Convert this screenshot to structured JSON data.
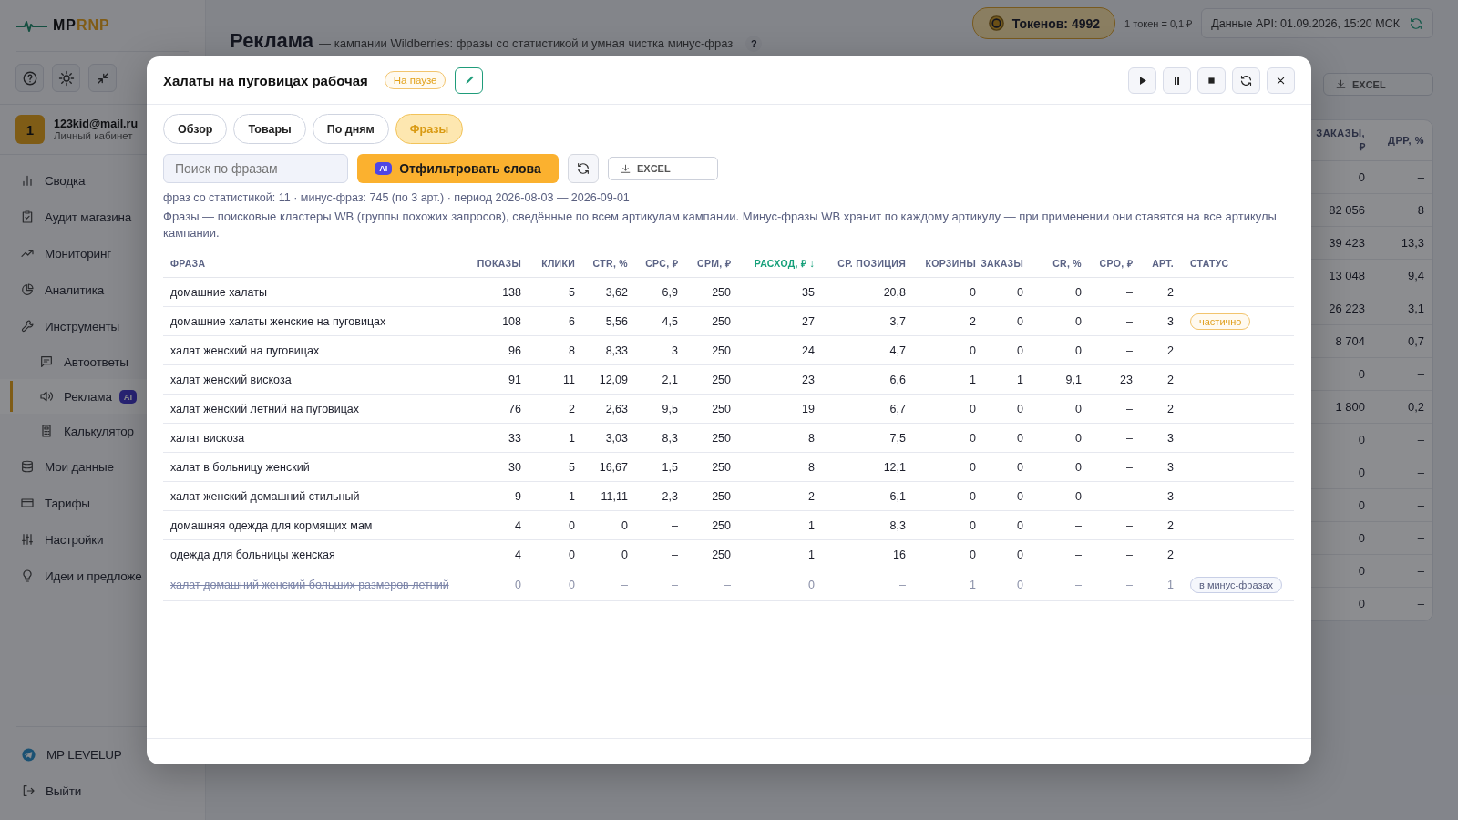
{
  "sidebar": {
    "logo": [
      "MP",
      "RNP"
    ],
    "user": {
      "avatar": "1",
      "email": "123kid@mail.ru",
      "subtitle": "Личный кабинет"
    },
    "nav": [
      {
        "label": "Сводка",
        "selected": false
      },
      {
        "label": "Аудит магазина",
        "selected": false
      },
      {
        "label": "Мониторинг",
        "selected": false
      },
      {
        "label": "Аналитика",
        "selected": false
      },
      {
        "label": "Инструменты",
        "selected": false,
        "children": [
          {
            "label": "Автоответы",
            "selected": false
          },
          {
            "label": "Реклама",
            "selected": true,
            "badge": "AI"
          },
          {
            "label": "Калькулятор",
            "selected": false
          }
        ]
      },
      {
        "label": "Мои данные",
        "selected": false
      },
      {
        "label": "Тарифы",
        "selected": false
      },
      {
        "label": "Настройки",
        "selected": false
      },
      {
        "label": "Идеи и предложе",
        "selected": false
      }
    ],
    "bottom_nav": [
      "MP LEVELUP",
      "Выйти"
    ]
  },
  "header": {
    "title": "Реклама",
    "subtitle": "— кампании Wildberries: фразы со статистикой и умная чистка минус-фраз",
    "help": "?",
    "tokens": "Токенов: 4992",
    "rate": "1 токен = 0,1 ₽",
    "api_status": "Данные API: 01.09.2026, 15:20 МСК"
  },
  "export_button": "EXCEL",
  "background_table": {
    "columns": [
      "ЗАКАЗЫ, ₽",
      "ДРР, %"
    ],
    "rows": [
      [
        "0",
        "–"
      ],
      [
        "82 056",
        "8"
      ],
      [
        "39 423",
        "13,3"
      ],
      [
        "13 048",
        "9,4"
      ],
      [
        "26 223",
        "3,1"
      ],
      [
        "8 704",
        "0,7"
      ],
      [
        "0",
        "–"
      ],
      [
        "1 800",
        "0,2"
      ],
      [
        "0",
        "–"
      ],
      [
        "0",
        "–"
      ],
      [
        "0",
        "–"
      ],
      [
        "0",
        "–"
      ],
      [
        "0",
        "–"
      ],
      [
        "0",
        "–"
      ]
    ]
  },
  "modal": {
    "title": "Халаты на пуговицах рабочая",
    "status": "На паузе",
    "tabs": [
      {
        "label": "Обзор",
        "selected": false
      },
      {
        "label": "Товары",
        "selected": false
      },
      {
        "label": "По дням",
        "selected": false
      },
      {
        "label": "Фразы",
        "selected": true
      }
    ],
    "search": {
      "placeholder": "Поиск по фразам"
    },
    "filter_button": {
      "badge": "AI",
      "label": "Отфильтровать слова"
    },
    "export_button": "EXCEL",
    "summary": "фраз со статистикой: 11 · минус-фраз: 745 (по 3 арт.) · период 2026-08-03 — 2026-09-01",
    "note": "Фразы — поисковые кластеры WB (группы похожих запросов), сведённые по всем артикулам кампании. Минус-фразы WB хранит по каждому артикулу — при применении они ставятся на все артикулы кампании.",
    "table": {
      "columns": [
        {
          "label": "ФРАЗА",
          "sorted": false
        },
        {
          "label": "ПОКАЗЫ",
          "sorted": false
        },
        {
          "label": "КЛИКИ",
          "sorted": false
        },
        {
          "label": "CTR, %",
          "sorted": false
        },
        {
          "label": "CPC, ₽",
          "sorted": false
        },
        {
          "label": "CPM, ₽",
          "sorted": false
        },
        {
          "label": "РАСХОД, ₽ ↓",
          "sorted": true
        },
        {
          "label": "СР. ПОЗИЦИЯ",
          "sorted": false
        },
        {
          "label": "КОРЗИНЫ",
          "sorted": false
        },
        {
          "label": "ЗАКАЗЫ",
          "sorted": false
        },
        {
          "label": "CR, %",
          "sorted": false
        },
        {
          "label": "CPO, ₽",
          "sorted": false
        },
        {
          "label": "АРТ.",
          "sorted": false
        },
        {
          "label": "СТАТУС",
          "sorted": false
        }
      ],
      "rows": [
        {
          "cells": [
            "домашние халаты",
            "138",
            "5",
            "3,62",
            "6,9",
            "250",
            "35",
            "20,8",
            "0",
            "0",
            "0",
            "–",
            "2"
          ],
          "excluded": false
        },
        {
          "cells": [
            "домашние халаты женские на пуговицах",
            "108",
            "6",
            "5,56",
            "4,5",
            "250",
            "27",
            "3,7",
            "2",
            "0",
            "0",
            "–",
            "3"
          ],
          "excluded": false,
          "status": {
            "label": "частично",
            "kind": "partial"
          }
        },
        {
          "cells": [
            "халат женский на пуговицах",
            "96",
            "8",
            "8,33",
            "3",
            "250",
            "24",
            "4,7",
            "0",
            "0",
            "0",
            "–",
            "2"
          ],
          "excluded": false
        },
        {
          "cells": [
            "халат женский вискоза",
            "91",
            "11",
            "12,09",
            "2,1",
            "250",
            "23",
            "6,6",
            "1",
            "1",
            "9,1",
            "23",
            "2"
          ],
          "excluded": false
        },
        {
          "cells": [
            "халат женский летний на пуговицах",
            "76",
            "2",
            "2,63",
            "9,5",
            "250",
            "19",
            "6,7",
            "0",
            "0",
            "0",
            "–",
            "2"
          ],
          "excluded": false
        },
        {
          "cells": [
            "халат вискоза",
            "33",
            "1",
            "3,03",
            "8,3",
            "250",
            "8",
            "7,5",
            "0",
            "0",
            "0",
            "–",
            "3"
          ],
          "excluded": false
        },
        {
          "cells": [
            "халат в больницу женский",
            "30",
            "5",
            "16,67",
            "1,5",
            "250",
            "8",
            "12,1",
            "0",
            "0",
            "0",
            "–",
            "3"
          ],
          "excluded": false
        },
        {
          "cells": [
            "халат женский домашний стильный",
            "9",
            "1",
            "11,11",
            "2,3",
            "250",
            "2",
            "6,1",
            "0",
            "0",
            "0",
            "–",
            "3"
          ],
          "excluded": false
        },
        {
          "cells": [
            "домашняя одежда для кормящих мам",
            "4",
            "0",
            "0",
            "–",
            "250",
            "1",
            "8,3",
            "0",
            "0",
            "–",
            "–",
            "2"
          ],
          "excluded": false
        },
        {
          "cells": [
            "одежда для больницы женская",
            "4",
            "0",
            "0",
            "–",
            "250",
            "1",
            "16",
            "0",
            "0",
            "–",
            "–",
            "2"
          ],
          "excluded": false
        },
        {
          "cells": [
            "халат домашний женский больших размеров летний",
            "0",
            "0",
            "–",
            "–",
            "–",
            "0",
            "–",
            "1",
            "0",
            "–",
            "–",
            "1"
          ],
          "excluded": true,
          "status": {
            "label": "в минус-фразах",
            "kind": "minus"
          }
        }
      ]
    }
  }
}
